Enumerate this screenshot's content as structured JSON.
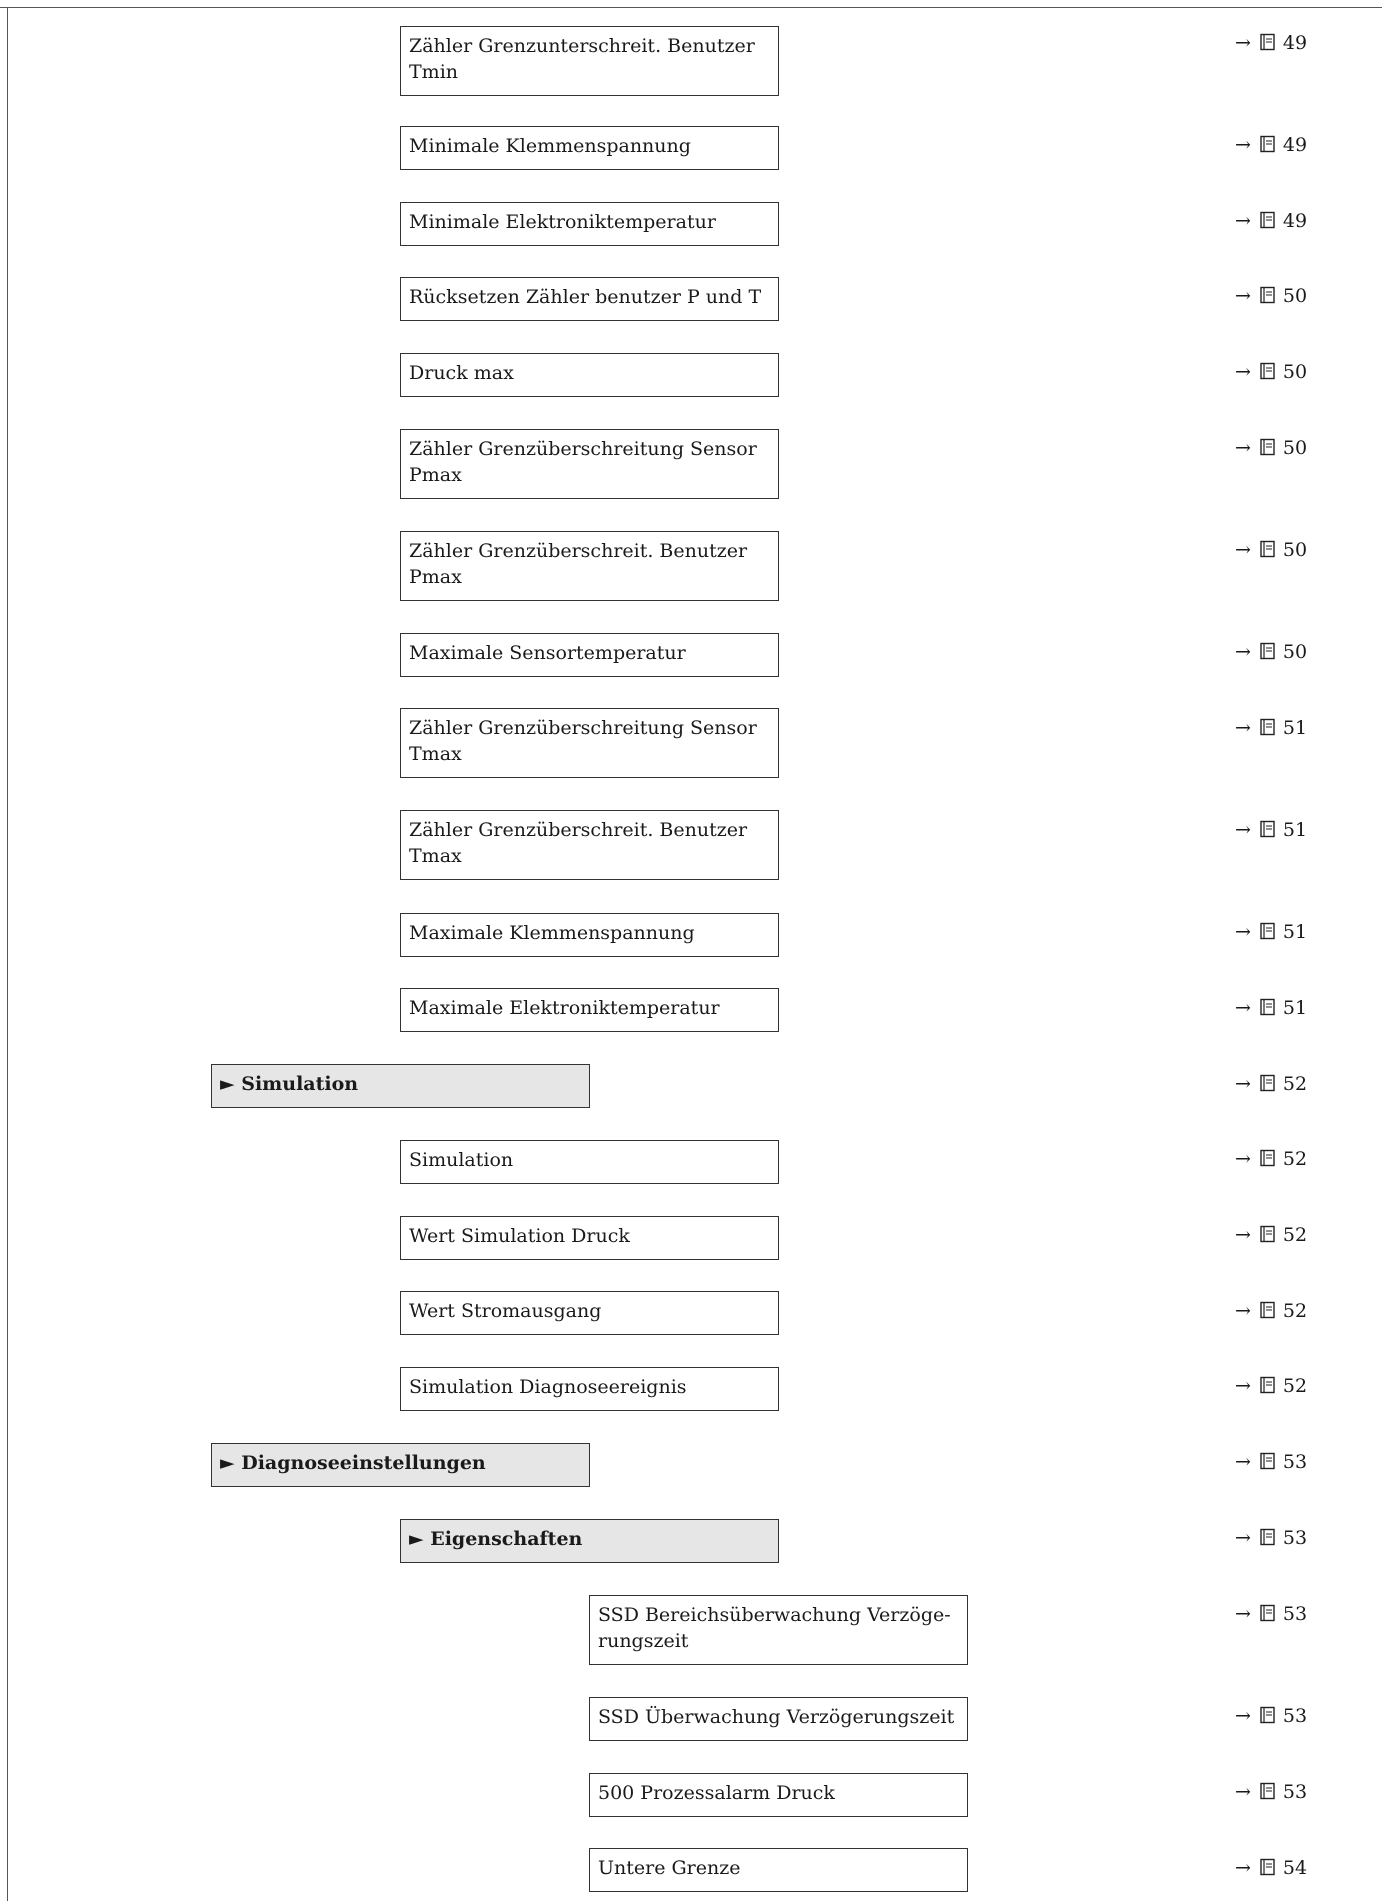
{
  "items": [
    {
      "label": "Zähler Grenzunterschreit. Benutzer Tmin",
      "page": "49"
    },
    {
      "label": "Minimale Klemmenspannung",
      "page": "49"
    },
    {
      "label": "Minimale Elektroniktemperatur",
      "page": "49"
    },
    {
      "label": "Rücksetzen Zähler benutzer P und T",
      "page": "50"
    },
    {
      "label": "Druck max",
      "page": "50"
    },
    {
      "label": "Zähler Grenzüberschreitung Sensor Pmax",
      "page": "50"
    },
    {
      "label": "Zähler Grenzüberschreit. Benutzer Pmax",
      "page": "50"
    },
    {
      "label": "Maximale Sensortemperatur",
      "page": "50"
    },
    {
      "label": "Zähler Grenzüberschreitung Sensor Tmax",
      "page": "51"
    },
    {
      "label": "Zähler Grenzüberschreit. Benutzer Tmax",
      "page": "51"
    },
    {
      "label": "Maximale Klemmenspannung",
      "page": "51"
    },
    {
      "label": "Maximale Elektroniktemperatur",
      "page": "51"
    },
    {
      "label": "► Simulation",
      "page": "52"
    },
    {
      "label": "Simulation",
      "page": "52"
    },
    {
      "label": "Wert Simulation Druck",
      "page": "52"
    },
    {
      "label": "Wert Stromausgang",
      "page": "52"
    },
    {
      "label": "Simulation Diagnoseereignis",
      "page": "52"
    },
    {
      "label": "► Diagnoseeinstellungen",
      "page": "53"
    },
    {
      "label": "► Eigenschaften",
      "page": "53"
    },
    {
      "label": "SSD Bereichsüberwachung Verzöge-rungszeit",
      "page": "53"
    },
    {
      "label": "SSD Überwachung Verzögerungszeit",
      "page": "53"
    },
    {
      "label": "500 Prozessalarm Druck",
      "page": "53"
    },
    {
      "label": "Untere Grenze",
      "page": "54"
    }
  ],
  "ref_arrow": "→",
  "icons": {
    "page_ref": "book-icon"
  }
}
